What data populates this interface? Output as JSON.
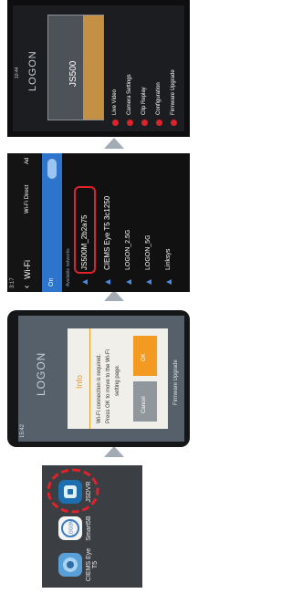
{
  "home": {
    "apps": [
      {
        "label": "CIEMS Eye T5",
        "icon": "ciems-eye-app-icon"
      },
      {
        "label": "Smart5B",
        "icon": "logon-app-icon"
      },
      {
        "label": "JSDVR",
        "icon": "jsdvr-app-icon"
      }
    ]
  },
  "dialog": {
    "status_time": "15:42",
    "brand": "LOGON",
    "title": "Info",
    "message_1": "Wi-Fi connection is required.",
    "message_2": "Press OK to move to the Wi-Fi",
    "message_3": "setting page.",
    "cancel": "Cancel",
    "ok": "OK",
    "bottom_item": "Firmware Upgrade"
  },
  "wifi": {
    "status_time": "3:17",
    "title": "Wi-Fi",
    "wifi_direct": "Wi-Fi Direct",
    "advanced": "Ad",
    "toggle": "On",
    "section": "Available networks",
    "networks": [
      "JS500M_2b2a75",
      "CIEMS Eye T5 3c1250",
      "LOGON_2.5G",
      "LOGON_5G",
      "Linksys"
    ]
  },
  "app": {
    "status_time": "10:44",
    "brand": "LOGON",
    "model": "JS500",
    "menu": [
      "Live Video",
      "Camera Settings",
      "Clip Replay",
      "Configuration",
      "Firmware Upgrade"
    ]
  },
  "colors": {
    "accent_red": "#e0222a",
    "ok_orange": "#f39a21",
    "arrow": "#a3acb4",
    "wifi_blue": "#4a8de0"
  }
}
